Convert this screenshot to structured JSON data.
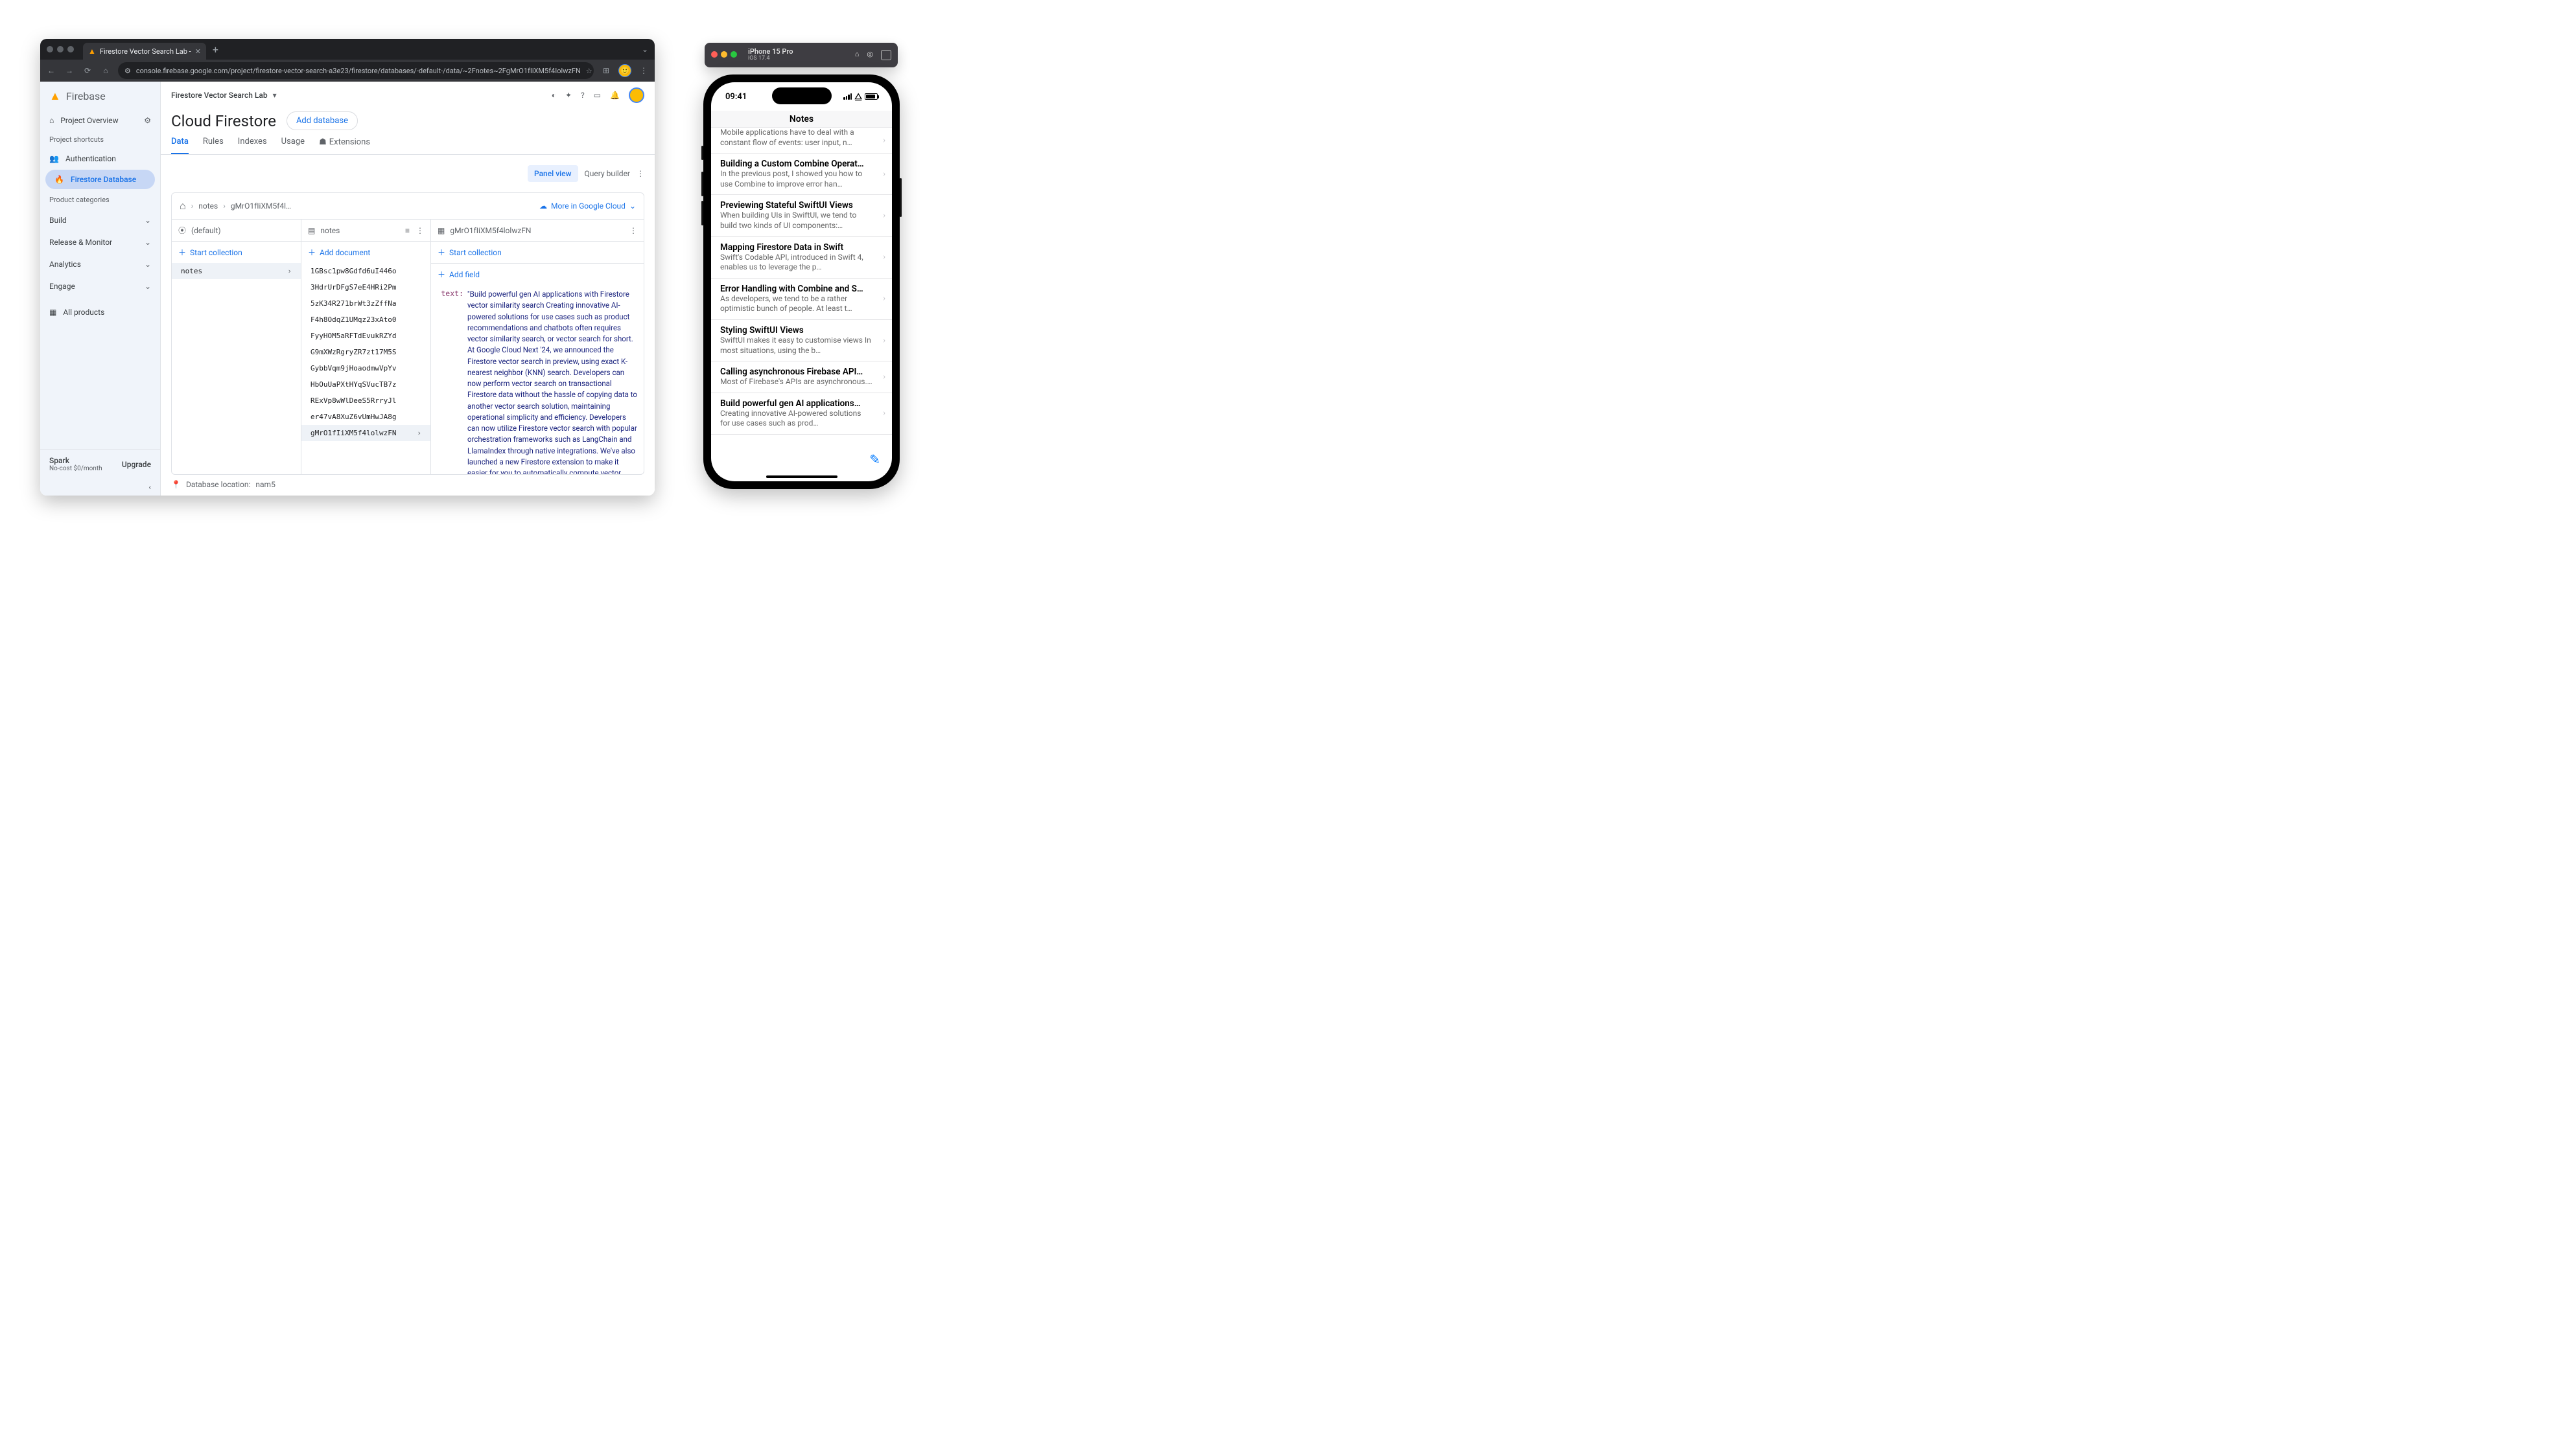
{
  "browser": {
    "tab_title": "Firestore Vector Search Lab - ",
    "url_display": "console.firebase.google.com/project/firestore-vector-search-a3e23/firestore/databases/-default-/data/~2Fnotes~2FgMrO1fIiXM5f4IolwzFN"
  },
  "firebase": {
    "brand": "Firebase",
    "project_name": "Firestore Vector Search Lab",
    "page_title": "Cloud Firestore",
    "add_db": "Add database",
    "tabs": {
      "data": "Data",
      "rules": "Rules",
      "indexes": "Indexes",
      "usage": "Usage",
      "extensions": "Extensions"
    },
    "view": {
      "panel": "Panel view",
      "query": "Query builder"
    },
    "sidebar": {
      "overview": "Project Overview",
      "shortcuts_label": "Project shortcuts",
      "auth": "Authentication",
      "firestore": "Firestore Database",
      "categories_label": "Product categories",
      "build": "Build",
      "release": "Release & Monitor",
      "analytics": "Analytics",
      "engage": "Engage",
      "all_products": "All products",
      "plan_name": "Spark",
      "plan_sub": "No-cost $0/month",
      "upgrade": "Upgrade"
    },
    "breadcrumb": {
      "root": "notes",
      "doc": "gMrO1fIiXM5f4l…",
      "more": "More in Google Cloud"
    },
    "col_root": {
      "label": "(default)",
      "start_collection": "Start collection",
      "item": "notes"
    },
    "col_notes": {
      "label": "notes",
      "add_document": "Add document",
      "docs": [
        "1GBsc1pw8Gdfd6uI446o",
        "3HdrUrDFgS7eE4HRi2Pm",
        "5zK34R271brWt3zZffNa",
        "F4h8OdqZ1UMqz23xAto0",
        "FyyHOM5aRFTdEvukRZYd",
        "G9mXWzRgryZR7zt17M5S",
        "GybbVqm9jHoaodmwVpYv",
        "HbOuUaPXtHYqSVucTB7z",
        "RExVp8wWlDeeS5RrryJl",
        "er47vA8XuZ6vUmHwJA8g",
        "gMrO1fIiXM5f4lolwzFN"
      ],
      "selected": 10
    },
    "col_doc": {
      "id": "gMrO1fIiXM5f4lolwzFN",
      "start_collection": "Start collection",
      "add_field": "Add field",
      "field_key": "text:",
      "field_value": "\"Build powerful gen AI applications with Firestore vector similarity search Creating innovative AI-powered solutions for use cases such as product recommendations and chatbots often requires vector similarity search, or vector search for short. At Google Cloud Next '24, we announced the Firestore vector search in preview, using exact K-nearest neighbor (KNN) search. Developers can now perform vector search on transactional Firestore data without the hassle of copying data to another vector search solution, maintaining operational simplicity and efficiency. Developers can now utilize Firestore vector search with popular orchestration frameworks such as LangChain and LlamaIndex through native integrations. We've also launched a new Firestore extension to make it easier for you to automatically compute vector embeddings on your data, and create web services that make it easier for you to perform vector searches from a web or mobile application. In this blog, we'll discuss how developers can get started with Firestore's new vector search"
    },
    "db_location_label": "Database location:",
    "db_location": "nam5"
  },
  "simulator": {
    "device": "iPhone 15 Pro",
    "os": "iOS 17.4"
  },
  "phone": {
    "time": "09:41",
    "nav_title": "Notes",
    "notes": [
      {
        "title": "",
        "subtitle": "Mobile applications have to deal with a constant flow of events: user input, n…"
      },
      {
        "title": "Building a Custom Combine Operat…",
        "subtitle": "In the previous post, I showed you how to use Combine to improve error han…"
      },
      {
        "title": "Previewing Stateful SwiftUI Views",
        "subtitle": "When building UIs in SwiftUI, we tend to build two kinds of UI components:…"
      },
      {
        "title": "Mapping Firestore Data in Swift",
        "subtitle": "Swift's Codable API, introduced in Swift 4, enables us to leverage the p…"
      },
      {
        "title": "Error Handling with Combine and S…",
        "subtitle": "As developers, we tend to be a rather optimistic bunch of people. At least t…"
      },
      {
        "title": "Styling SwiftUI Views",
        "subtitle": "SwiftUI makes it easy to customise views In most situations, using the b…"
      },
      {
        "title": "Calling asynchronous Firebase API…",
        "subtitle": "Most of Firebase's APIs are asynchronous.…"
      },
      {
        "title": "Build powerful gen AI applications…",
        "subtitle": "Creating innovative AI-powered solutions for use cases such as prod…"
      }
    ]
  }
}
